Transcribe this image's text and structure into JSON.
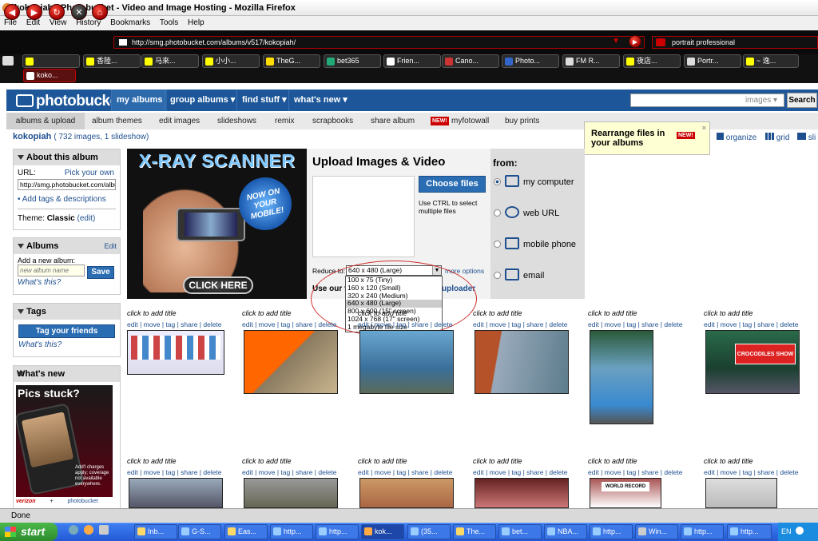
{
  "window": {
    "title": "kokopiah - Photobucket - Video and Image Hosting - Mozilla Firefox"
  },
  "menu": [
    "File",
    "Edit",
    "View",
    "History",
    "Bookmarks",
    "Tools",
    "Help"
  ],
  "browser": {
    "url": "http://smg.photobucket.com/albums/v517/kokopiah/",
    "search": "portrait professional",
    "tabs_row1": [
      "",
      "香陸...",
      "马來...",
      "小小...",
      "TheG...",
      "bet365",
      "Frien...",
      "Cano...",
      "Photo...",
      "FM R...",
      "夜店...",
      "Portr...",
      "~ 逸..."
    ],
    "tabs_row2": [
      "koko..."
    ]
  },
  "pb": {
    "logo": "photobucket",
    "nav": [
      "my albums",
      "group albums ▾",
      "find stuff ▾",
      "what's new ▾"
    ],
    "search_placeholder": "images ▾",
    "search_button": "Search",
    "subnav": [
      "albums & upload",
      "album themes",
      "edit images",
      "slideshows",
      "remix",
      "scrapbooks",
      "share album",
      "myfotowall",
      "buy prints"
    ],
    "new_badge": "NEW!",
    "crumb_user": "kokopiah",
    "crumb_count": "( 732 images, 1 slideshow)",
    "view_modes": [
      "organize",
      "grid",
      "sli"
    ]
  },
  "tooltip": {
    "text": "Rearrange files in your albums",
    "badge": "NEW!"
  },
  "sidebar": {
    "about": {
      "title": "About this album",
      "url_label": "URL:",
      "pick": "Pick your own",
      "url_value": "http://smg.photobucket.com/albu",
      "add_tags": "Add tags & descriptions",
      "theme_label": "Theme:",
      "theme_value": "Classic",
      "theme_edit": "(edit)"
    },
    "albums": {
      "title": "Albums",
      "edit": "Edit",
      "add_label": "Add a new album:",
      "placeholder": "new album name",
      "save": "Save",
      "whats_this": "What's this?"
    },
    "tags": {
      "title": "Tags",
      "button": "Tag your friends",
      "whats_this": "What's this?"
    },
    "whats_new": {
      "title": "What's new",
      "ad_headline": "Pics stuck?",
      "ad_fine": "Add'l charges apply; coverage not available everywhere.",
      "ad_brand": "verizon",
      "ad_plus": "+",
      "ad_pb": "photobucket"
    }
  },
  "ad": {
    "title": "X-RAY SCANNER",
    "badge": "NOW ON YOUR MOBILE!",
    "cta": "CLICK HERE"
  },
  "upload": {
    "title": "Upload Images & Video",
    "choose": "Choose files",
    "hint": "Use CTRL to select multiple files",
    "reduce_label": "Reduce to:",
    "reduce_value": "640 x 480 (Large)",
    "more_options": "more options",
    "use_our": "Use our fa",
    "uploader": "uploader",
    "options": [
      "100 x 75 (Tiny)",
      "160 x 120 (Small)",
      "320 x 240 (Medium)",
      "640 x 480 (Large)",
      "800 x 600 (15\" screen)",
      "1024 x 768 (17\" screen)",
      "1 megabyte file size"
    ],
    "selected_index": 3
  },
  "from": {
    "title": "from:",
    "options": [
      "my computer",
      "web URL",
      "mobile phone",
      "email"
    ]
  },
  "thumbs": {
    "caption": "click to add title",
    "links": [
      "edit",
      "move",
      "tag",
      "share",
      "delete"
    ],
    "sign_text": "CROCODILES SHOW",
    "sign2_text": "WORLD RECORD"
  },
  "status": "Done",
  "taskbar": {
    "start": "start",
    "items": [
      "Inb...",
      "G-S...",
      "Eas...",
      "http...",
      "http...",
      "kok...",
      "(35...",
      "The...",
      "bet...",
      "NBA...",
      "http...",
      "Win...",
      "http...",
      "http..."
    ],
    "lang": "EN"
  }
}
